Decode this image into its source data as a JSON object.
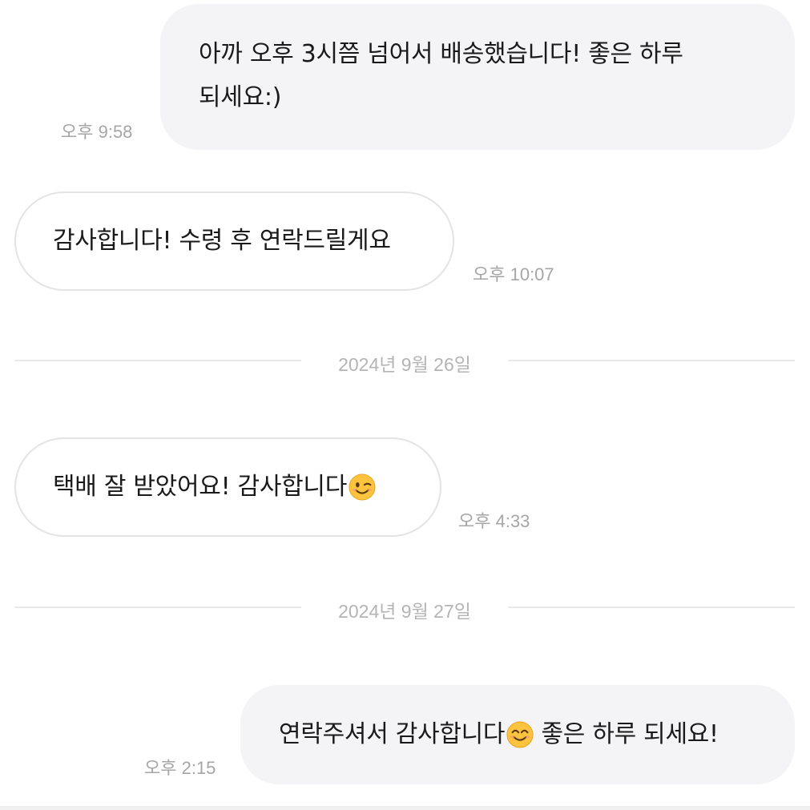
{
  "messages": [
    {
      "direction": "sent",
      "text_line1": "아까 오후 3시쯤 넘어서 배송했습니다! 좋은 하루",
      "text_line2": "되세요:)",
      "time": "오후 9:58"
    },
    {
      "direction": "received",
      "text": "감사합니다! 수령 후 연락드릴게요",
      "time": "오후 10:07"
    },
    {
      "direction": "received",
      "text": "택배 잘 받았어요! 감사합니다",
      "emoji": "winking-face-emoji",
      "time": "오후 4:33"
    },
    {
      "direction": "sent",
      "text_before": "연락주셔서 감사합니다",
      "emoji": "smiling-face-emoji",
      "text_after": " 좋은 하루 되세요!",
      "time": "오후 2:15"
    }
  ],
  "date_separators": [
    {
      "label": "2024년 9월 26일"
    },
    {
      "label": "2024년 9월 27일"
    }
  ],
  "colors": {
    "sent_bubble": "#f4f4f6",
    "received_border": "#e4e4e4",
    "timestamp": "#a6a6a6",
    "emoji_face": "#fcc43e"
  }
}
